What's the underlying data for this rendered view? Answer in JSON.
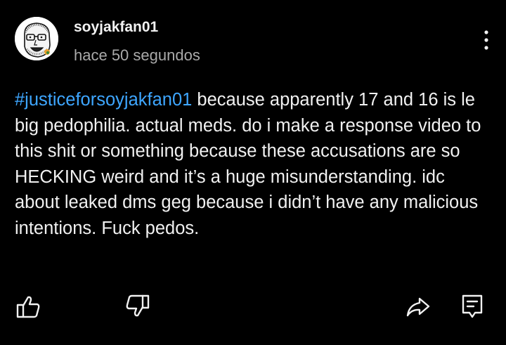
{
  "comment": {
    "author": "soyjakfan01",
    "timestamp": "hace 50 segundos",
    "hashtag": "#justiceforsoyjakfan01",
    "text": " because apparently 17 and 16 is le big pedophilia. actual meds. do i make a response video to this shit or something because these accusations are so HECKING weird and it’s a huge misunderstanding. idc about leaked dms geg because i didn’t have any malicious intentions. Fuck pedos."
  },
  "avatar_icon": "soyjak-face-icon",
  "actions": {
    "like_icon": "thumbs-up-icon",
    "dislike_icon": "thumbs-down-icon",
    "share_icon": "share-arrow-icon",
    "reply_icon": "comment-reply-icon",
    "more_icon": "vertical-ellipsis-icon"
  },
  "colors": {
    "background": "#000000",
    "text": "#f1f1f1",
    "secondary_text": "#aaaaaa",
    "hashtag": "#3ea6ff"
  }
}
